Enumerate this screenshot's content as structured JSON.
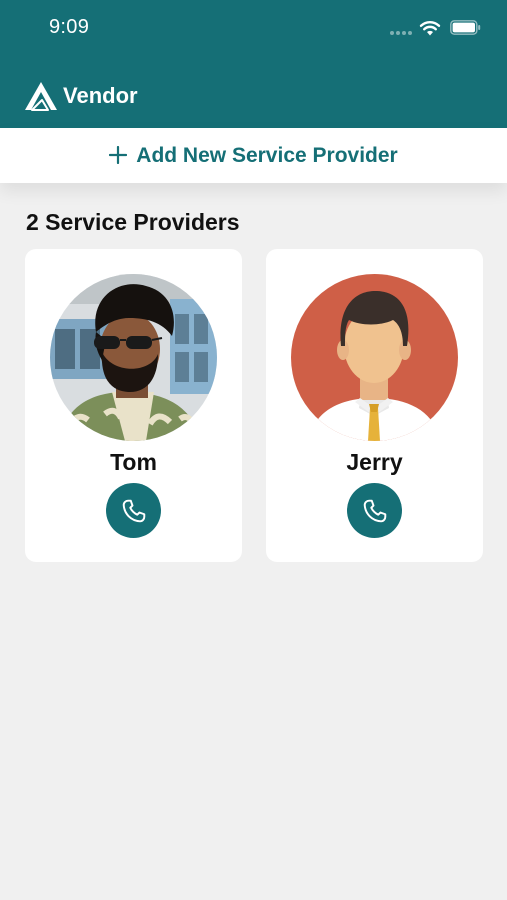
{
  "status_bar": {
    "time": "9:09"
  },
  "header": {
    "title": "Vendor"
  },
  "add_bar": {
    "label": "Add New Service Provider"
  },
  "section": {
    "title": "2 Service Providers"
  },
  "providers": [
    {
      "name": "Tom",
      "avatar": "photo-avatar",
      "action_icon": "phone-icon"
    },
    {
      "name": "Jerry",
      "avatar": "illustrated-avatar",
      "action_icon": "phone-icon"
    }
  ],
  "colors": {
    "primary": "#156f76",
    "background": "#f0f0f0",
    "card": "#ffffff",
    "jerry_avatar_bg": "#cf5f47"
  }
}
